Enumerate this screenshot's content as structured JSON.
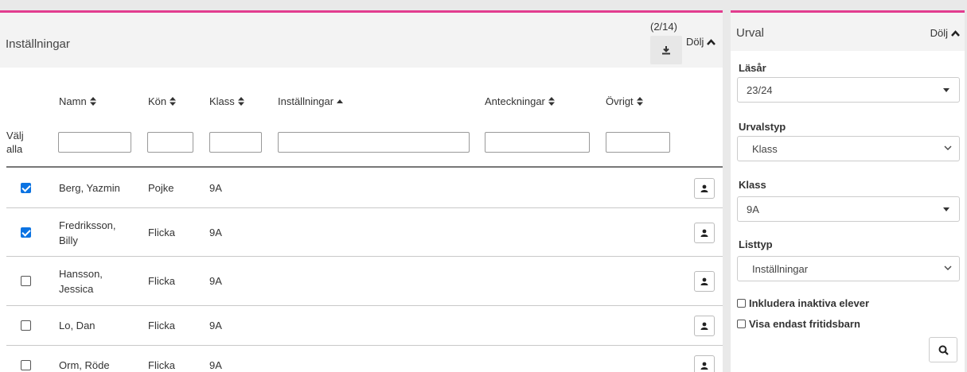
{
  "left_panel": {
    "title": "Inställningar",
    "count": "(2/14)",
    "hide_label": "Dölj"
  },
  "table": {
    "headers": {
      "name": "Namn",
      "gender": "Kön",
      "class": "Klass",
      "settings": "Inställningar",
      "notes": "Anteckningar",
      "other": "Övrigt"
    },
    "select_all": "Välj alla",
    "rows": [
      {
        "name": "Berg, Yazmin",
        "gender": "Pojke",
        "class": "9A",
        "checked": true
      },
      {
        "name": "Fredriksson, Billy",
        "gender": "Flicka",
        "class": "9A",
        "checked": true
      },
      {
        "name": "Hansson, Jessica",
        "gender": "Flicka",
        "class": "9A",
        "checked": false
      },
      {
        "name": "Lo, Dan",
        "gender": "Flicka",
        "class": "9A",
        "checked": false
      },
      {
        "name": "Orm, Röde",
        "gender": "Flicka",
        "class": "9A",
        "checked": false
      }
    ]
  },
  "right_panel": {
    "title": "Urval",
    "hide_label": "Dölj",
    "fields": {
      "school_year_label": "Läsår",
      "school_year_value": "23/24",
      "selection_type_label": "Urvalstyp",
      "selection_type_value": "Klass",
      "class_label": "Klass",
      "class_value": "9A",
      "list_type_label": "Listtyp",
      "list_type_value": "Inställningar"
    },
    "include_inactive_label": "Inkludera inaktiva elever",
    "only_leisure_label": "Visa endast fritidsbarn"
  },
  "colors": {
    "accent": "#e23c8f",
    "checkbox": "#0b73e2"
  },
  "icons": {
    "download": "download-icon",
    "hide": "chevron-up-icon",
    "sort": "sort-icon",
    "sort_asc": "sort-asc-icon",
    "person": "person-icon",
    "search": "search-icon",
    "dropdown": "caret-down-icon",
    "select": "chevron-down-icon"
  }
}
